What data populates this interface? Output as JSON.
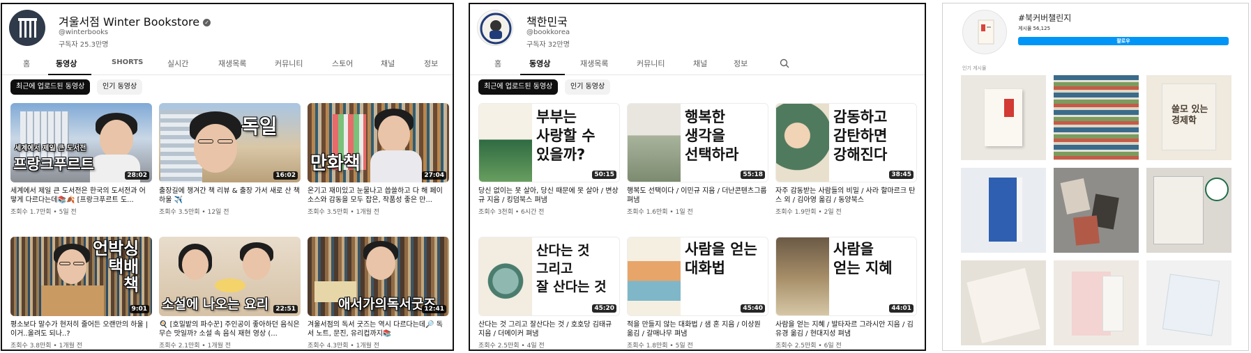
{
  "panel1": {
    "channel_name": "겨울서점 Winter Bookstore",
    "handle": "@winterbooks",
    "subscribers": "구독자 25.3만명",
    "tabs": [
      "홈",
      "동영상",
      "SHORTS",
      "실시간",
      "재생목록",
      "커뮤니티",
      "스토어",
      "채널",
      "정보"
    ],
    "chips": [
      "최근에 업로드된 동영상",
      "인기 동영상"
    ],
    "videos": [
      {
        "overlay": "프랑크푸르트",
        "overlay_top": "세계에서 제일 큰 도서전",
        "duration": "28:02",
        "title": "세계에서 제일 큰 도서전은 한국의 도서전과 어떻게 다르다는데📚🍂 [프랑크푸르트 도...",
        "meta": "조회수 1.7만회 • 5일 전"
      },
      {
        "overlay": "독일",
        "duration": "16:02",
        "title": "출장길에 챙겨간 책 리뷰 & 출장 가서 새로 산 책 하울 ✈️",
        "meta": "조회수 3.5만회 • 12일 전"
      },
      {
        "overlay": "만화책",
        "duration": "27:04",
        "title": "온기고 재미있고 눈물나고 씁쓸하고 다 해 페이소스와 감동을 모두 잡은, 작품성 좋은 만...",
        "meta": "조회수 3.5만회 • 1개월 전"
      },
      {
        "overlay": "언박싱\n택배\n책",
        "duration": "9:01",
        "title": "평소보다 말수가 현저히 줄어든 오랜만의 하울 | 이거..올려도 되나..?",
        "meta": "조회수 3.8만회 • 1개월 전"
      },
      {
        "overlay": "소설에 나오는 요리",
        "duration": "22:51",
        "title": "🍳 [호밀밭의 파수꾼] 주인공이 좋아하던 음식은 무슨 맛일까? 소설 속 음식 재현 영상 (...",
        "meta": "조회수 2.1만회 • 1개월 전"
      },
      {
        "overlay": "애서가의독서굿즈",
        "duration": "12:41",
        "title": "겨울서점의 독서 굿즈는 역시 다르다는데🔎 독서 노트, 문진, 유리컵까지📚",
        "meta": "조회수 4.3만회 • 1개월 전"
      }
    ]
  },
  "panel2": {
    "channel_name": "책한민국",
    "handle": "@bookkorea",
    "subscribers": "구독자 32만명",
    "tabs": [
      "홈",
      "동영상",
      "재생목록",
      "커뮤니티",
      "채널",
      "정보"
    ],
    "chips": [
      "최근에 업로드된 동영상",
      "인기 동영상"
    ],
    "videos": [
      {
        "big_title": "부부는\n사랑할 수\n있을까?",
        "duration": "50:15",
        "title": "당신 없이는 못 살아, 당신 때문에 못 살아 / 변상규 지음 / 킹덤북스 펴냄",
        "meta": "조회수 3천회 • 6시간 전"
      },
      {
        "big_title": "행복한\n생각을\n선택하라",
        "duration": "55:18",
        "title": "행복도 선택이다 / 이민규 지음 / 더난콘텐츠그룹 펴냄",
        "meta": "조회수 1.6만회 • 1일 전"
      },
      {
        "big_title": "감동하고\n감탄하면\n강해진다",
        "duration": "38:45",
        "title": "자주 감동받는 사람들의 비밀 / 사라 할마르크 탄스 외 / 김아영 옮김 / 동양북스",
        "meta": "조회수 1.9만회 • 2일 전"
      },
      {
        "big_title": "산다는 것\n그리고\n잘 산다는 것",
        "duration": "45:20",
        "title": "산다는 것 그리고 잘산다는 것 / 호호당 김태규 지음 / 더메이커 펴냄",
        "meta": "조회수 2.5만회 • 4일 전"
      },
      {
        "big_title": "사람을 얻는\n대화법",
        "duration": "45:40",
        "title": "적을 만들지 않는 대화법 / 샘 혼 지음 / 이상원 옮김 / 갈매나무 펴냄",
        "meta": "조회수 1.8만회 • 5일 전"
      },
      {
        "big_title": "사람을\n얻는 지혜",
        "duration": "44:01",
        "title": "사람을 얻는 지혜 / 발타자르 그라시안 지음 / 김유경 옮김 / 현대지성 펴냄",
        "meta": "조회수 2.5만회 • 6일 전"
      }
    ]
  },
  "panel3": {
    "hashtag": "#북커버챌린지",
    "posts": "게시물 56,125",
    "follow_label": "팔로우",
    "section_label": "인기 게시물",
    "cells": [
      {
        "text": ""
      },
      {
        "text": ""
      },
      {
        "text": "쓸모 있는\n경제학"
      },
      {
        "text": ""
      },
      {
        "text": ""
      },
      {
        "text": ""
      },
      {
        "text": ""
      },
      {
        "text": ""
      },
      {
        "text": ""
      }
    ]
  },
  "colors": {
    "accent": "#0095f6",
    "chip_dark": "#0f0f0f",
    "meta": "#606060"
  }
}
